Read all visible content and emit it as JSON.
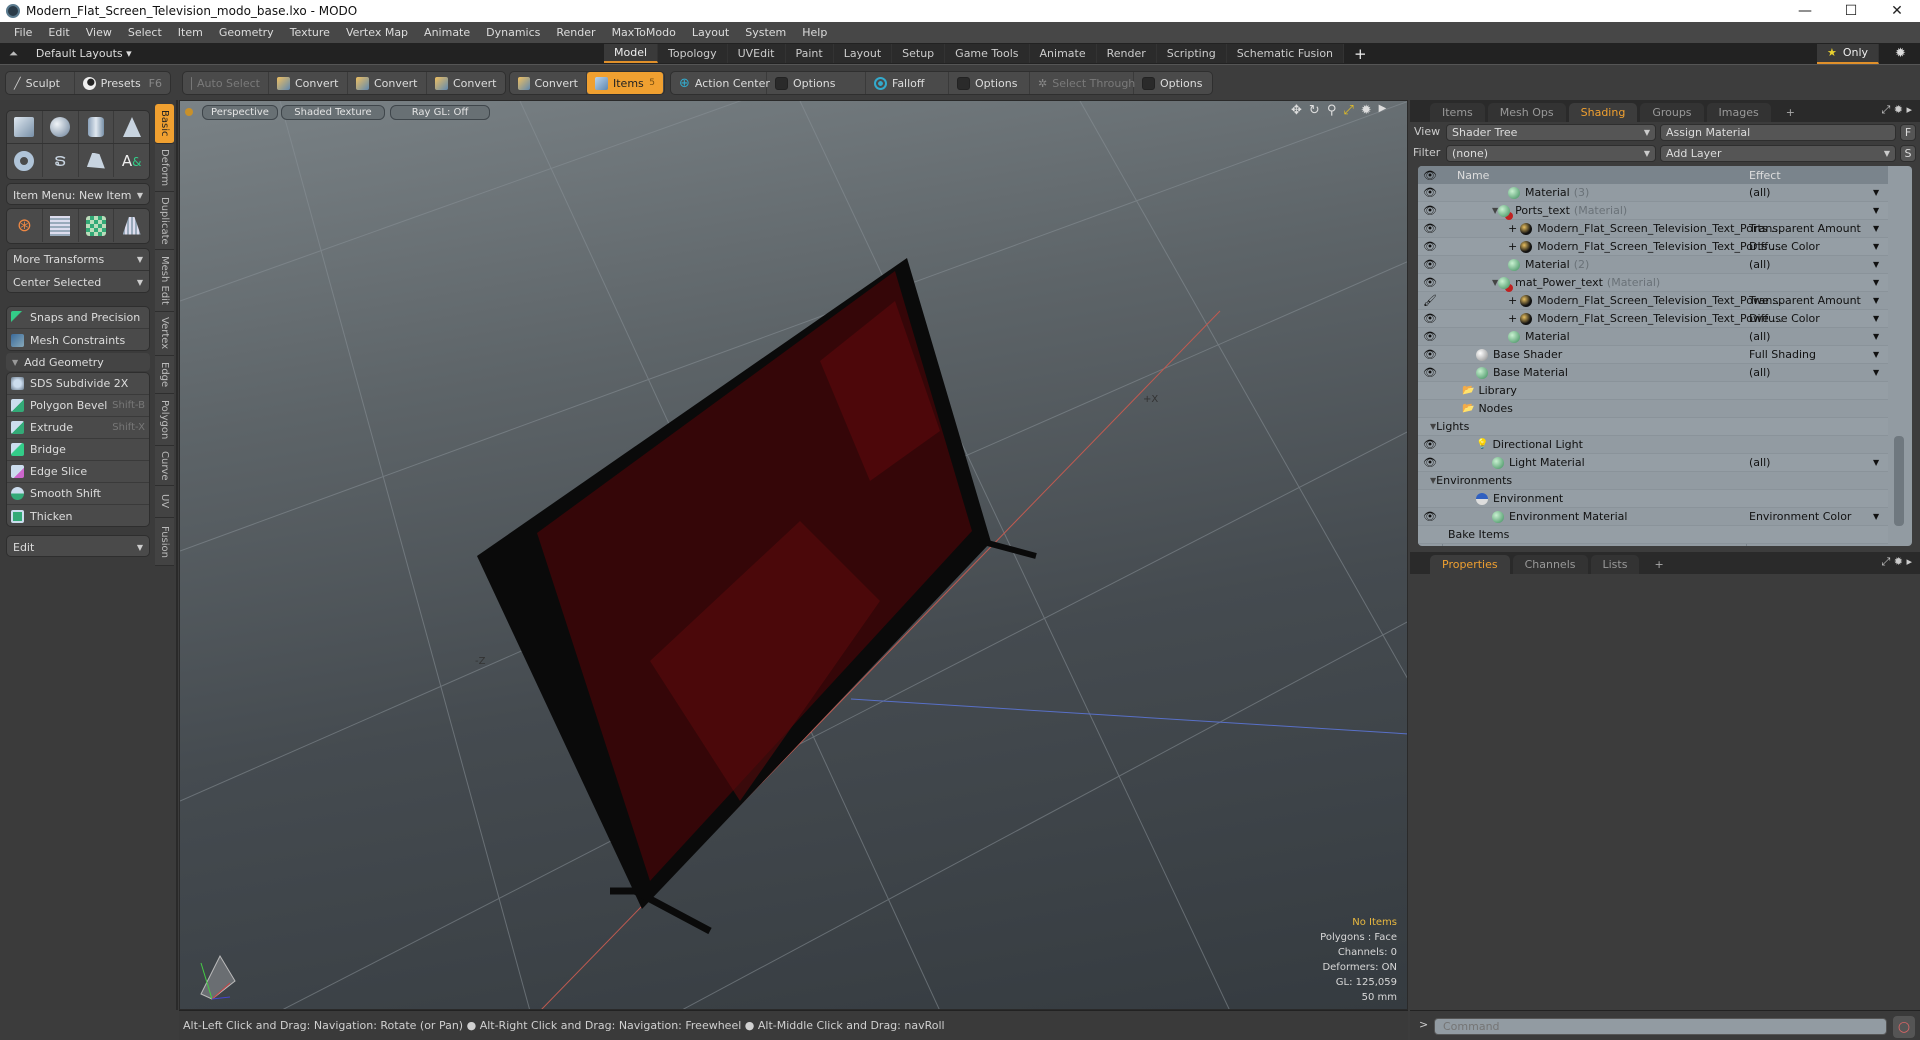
{
  "window": {
    "title": "Modern_Flat_Screen_Television_modo_base.lxo - MODO",
    "controls": [
      "minimize",
      "maximize",
      "close"
    ]
  },
  "menu": [
    "File",
    "Edit",
    "View",
    "Select",
    "Item",
    "Geometry",
    "Texture",
    "Vertex Map",
    "Animate",
    "Dynamics",
    "Render",
    "MaxToModo",
    "Layout",
    "System",
    "Help"
  ],
  "layoutbar": {
    "layouts_label": "Default Layouts ▾",
    "tabs": [
      "Model",
      "Topology",
      "UVEdit",
      "Paint",
      "Layout",
      "Setup",
      "Game Tools",
      "Animate",
      "Render",
      "Scripting",
      "Schematic Fusion"
    ],
    "active_tab": "Model",
    "add_label": "+",
    "only_label": "Only"
  },
  "toolbar": {
    "sculpt": "Sculpt",
    "presets": "Presets",
    "presets_hotkey": "F6",
    "auto_select": "Auto Select",
    "convert1": "Convert",
    "convert2": "Convert",
    "convert3": "Convert",
    "convert4": "Convert",
    "items": "Items",
    "items_count": "5",
    "action_center": "Action Center",
    "options1": "Options",
    "falloff": "Falloff",
    "options2": "Options",
    "select_through": "Select Through",
    "options3": "Options"
  },
  "leftpanel": {
    "item_menu": "Item Menu: New Item",
    "more_transforms": "More Transforms",
    "center_selected": "Center Selected",
    "snaps": "Snaps and Precision",
    "mesh_constraints": "Mesh Constraints",
    "add_geometry": "Add Geometry",
    "tools": [
      {
        "label": "SDS Subdivide 2X",
        "hotkey": ""
      },
      {
        "label": "Polygon Bevel",
        "hotkey": "Shift-B"
      },
      {
        "label": "Extrude",
        "hotkey": "Shift-X"
      },
      {
        "label": "Bridge",
        "hotkey": ""
      },
      {
        "label": "Edge Slice",
        "hotkey": ""
      },
      {
        "label": "Smooth Shift",
        "hotkey": ""
      },
      {
        "label": "Thicken",
        "hotkey": ""
      }
    ],
    "edit": "Edit",
    "vtabs": [
      "Basic",
      "Deform",
      "Duplicate",
      "Mesh Edit",
      "Vertex",
      "Edge",
      "Polygon",
      "Curve",
      "UV",
      "Fusion"
    ]
  },
  "viewport": {
    "view": "Perspective",
    "shading": "Shaded Texture",
    "raygl": "Ray GL: Off",
    "axis_labels": {
      "x": "+X",
      "z": "-Z"
    },
    "info": {
      "items": "No Items",
      "polygons": "Polygons : Face",
      "channels": "Channels: 0",
      "deformers": "Deformers: ON",
      "gl": "GL: 125,059",
      "scale": "50 mm"
    }
  },
  "status": {
    "hint": "Alt-Left Click and Drag: Navigation: Rotate (or Pan) ● Alt-Right Click and Drag: Navigation: Freewheel ● Alt-Middle Click and Drag: navRoll"
  },
  "rightpanel": {
    "tabs": [
      "Items",
      "Mesh Ops",
      "Shading",
      "Groups",
      "Images"
    ],
    "active_tab": "Shading",
    "view_label": "View",
    "view_value": "Shader Tree",
    "assign_material": "Assign Material",
    "f_button": "F",
    "filter_label": "Filter",
    "filter_value": "(none)",
    "add_layer": "Add Layer",
    "s_button": "S",
    "col_name": "Name",
    "col_effect": "Effect",
    "rows": [
      {
        "name": "Material",
        "suffix": "(3)",
        "effect": "(all)",
        "icon": "g",
        "eye": "👁",
        "indent": 3
      },
      {
        "name": "Ports_text",
        "suffix": "(Material)",
        "effect": "",
        "icon": "r",
        "eye": "👁",
        "indent": 2
      },
      {
        "name": "Modern_Flat_Screen_Television_Text_Ports ...",
        "suffix": "",
        "effect": "Transparent Amount",
        "icon": "b",
        "eye": "👁",
        "indent": 3
      },
      {
        "name": "Modern_Flat_Screen_Television_Text_Ports ...",
        "suffix": "",
        "effect": "Diffuse Color",
        "icon": "b",
        "eye": "👁",
        "indent": 3
      },
      {
        "name": "Material",
        "suffix": "(2)",
        "effect": "(all)",
        "icon": "g",
        "eye": "👁",
        "indent": 3
      },
      {
        "name": "mat_Power_text",
        "suffix": "(Material)",
        "effect": "",
        "icon": "r",
        "eye": "👁",
        "indent": 2
      },
      {
        "name": "Modern_Flat_Screen_Television_Text_Powe ...",
        "suffix": "",
        "effect": "Transparent Amount",
        "icon": "b",
        "eye": "🖌",
        "indent": 3
      },
      {
        "name": "Modern_Flat_Screen_Television_Text_Powe ...",
        "suffix": "",
        "effect": "Diffuse Color",
        "icon": "b",
        "eye": "👁",
        "indent": 3
      },
      {
        "name": "Material",
        "suffix": "",
        "effect": "(all)",
        "icon": "g",
        "eye": "👁",
        "indent": 3
      },
      {
        "name": "Base Shader",
        "suffix": "",
        "effect": "Full Shading",
        "icon": "w",
        "eye": "👁",
        "indent": 1
      },
      {
        "name": "Base Material",
        "suffix": "",
        "effect": "(all)",
        "icon": "g",
        "eye": "👁",
        "indent": 1
      },
      {
        "name": "Library",
        "suffix": "",
        "effect": "",
        "icon": "folder",
        "eye": "",
        "indent": 0
      },
      {
        "name": "Nodes",
        "suffix": "",
        "effect": "",
        "icon": "folder",
        "eye": "",
        "indent": 0
      },
      {
        "name": "Lights",
        "suffix": "",
        "effect": "",
        "icon": "",
        "eye": "",
        "indent": -1
      },
      {
        "name": "Directional Light",
        "suffix": "",
        "effect": "",
        "icon": "light",
        "eye": "👁",
        "indent": 1
      },
      {
        "name": "Light Material",
        "suffix": "",
        "effect": "(all)",
        "icon": "g",
        "eye": "👁",
        "indent": 2
      },
      {
        "name": "Environments",
        "suffix": "",
        "effect": "",
        "icon": "",
        "eye": "",
        "indent": -1
      },
      {
        "name": "Environment",
        "suffix": "",
        "effect": "",
        "icon": "env",
        "eye": "",
        "indent": 1
      },
      {
        "name": "Environment Material",
        "suffix": "",
        "effect": "Environment Color",
        "icon": "g",
        "eye": "👁",
        "indent": 2
      },
      {
        "name": "Bake Items",
        "suffix": "",
        "effect": "",
        "icon": "",
        "eye": "",
        "indent": -1
      }
    ],
    "bottom_tabs": [
      "Properties",
      "Channels",
      "Lists"
    ],
    "bottom_active": "Properties",
    "command_placeholder": "Command",
    "prompt": ">"
  },
  "colors": {
    "accent": "#f0a030",
    "tree_bg": "#929ba2",
    "viewport_top": "#7a8286",
    "viewport_bottom": "#353b40"
  }
}
